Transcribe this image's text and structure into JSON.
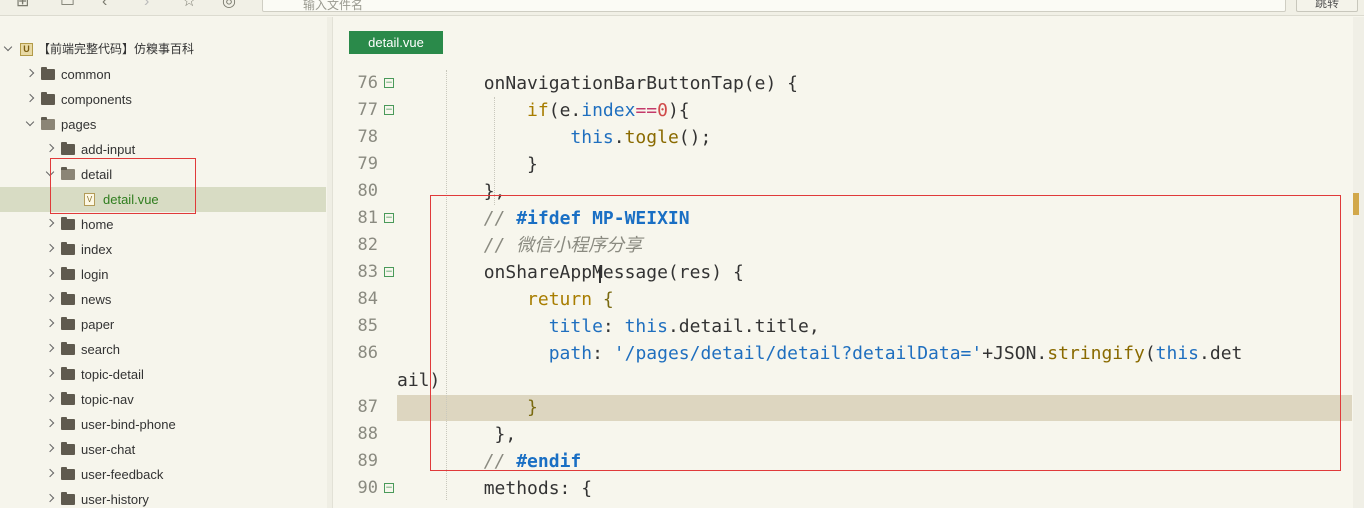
{
  "toolbar": {
    "address_placeholder": "输入文件名",
    "go_button": "跳转"
  },
  "sidebar": {
    "project": "【前端完整代码】仿糗事百科",
    "items": [
      {
        "label": "common",
        "depth": 1,
        "type": "folder",
        "expanded": false
      },
      {
        "label": "components",
        "depth": 1,
        "type": "folder",
        "expanded": false
      },
      {
        "label": "pages",
        "depth": 1,
        "type": "folder",
        "expanded": true
      },
      {
        "label": "add-input",
        "depth": 2,
        "type": "folder",
        "expanded": false
      },
      {
        "label": "detail",
        "depth": 2,
        "type": "folder",
        "expanded": true
      },
      {
        "label": "detail.vue",
        "depth": 3,
        "type": "file",
        "selected": true
      },
      {
        "label": "home",
        "depth": 2,
        "type": "folder",
        "expanded": false
      },
      {
        "label": "index",
        "depth": 2,
        "type": "folder",
        "expanded": false
      },
      {
        "label": "login",
        "depth": 2,
        "type": "folder",
        "expanded": false
      },
      {
        "label": "news",
        "depth": 2,
        "type": "folder",
        "expanded": false
      },
      {
        "label": "paper",
        "depth": 2,
        "type": "folder",
        "expanded": false
      },
      {
        "label": "search",
        "depth": 2,
        "type": "folder",
        "expanded": false
      },
      {
        "label": "topic-detail",
        "depth": 2,
        "type": "folder",
        "expanded": false
      },
      {
        "label": "topic-nav",
        "depth": 2,
        "type": "folder",
        "expanded": false
      },
      {
        "label": "user-bind-phone",
        "depth": 2,
        "type": "folder",
        "expanded": false
      },
      {
        "label": "user-chat",
        "depth": 2,
        "type": "folder",
        "expanded": false
      },
      {
        "label": "user-feedback",
        "depth": 2,
        "type": "folder",
        "expanded": false
      },
      {
        "label": "user-history",
        "depth": 2,
        "type": "folder",
        "expanded": false
      }
    ]
  },
  "editor": {
    "tab": "detail.vue",
    "lines": [
      {
        "n": "76",
        "fold": true,
        "tokens": [
          [
            "def",
            "        onNavigationBarButtonTap(e) {"
          ]
        ]
      },
      {
        "n": "77",
        "fold": true,
        "tokens": [
          [
            "def",
            "            "
          ],
          [
            "kw",
            "if"
          ],
          [
            "def",
            "(e."
          ],
          [
            "prop",
            "index"
          ],
          [
            "op",
            "=="
          ],
          [
            "num",
            "0"
          ],
          [
            "def",
            "){"
          ]
        ]
      },
      {
        "n": "78",
        "fold": false,
        "tokens": [
          [
            "def",
            "                "
          ],
          [
            "this",
            "this"
          ],
          [
            "def",
            "."
          ],
          [
            "fn",
            "togle"
          ],
          [
            "def",
            "();"
          ]
        ]
      },
      {
        "n": "79",
        "fold": false,
        "tokens": [
          [
            "def",
            "            }"
          ]
        ]
      },
      {
        "n": "80",
        "fold": false,
        "tokens": [
          [
            "def",
            "        },"
          ]
        ]
      },
      {
        "n": "81",
        "fold": true,
        "tokens": [
          [
            "def",
            "        "
          ],
          [
            "com",
            "// "
          ],
          [
            "pre",
            "#ifdef MP-WEIXIN"
          ]
        ]
      },
      {
        "n": "82",
        "fold": false,
        "tokens": [
          [
            "def",
            "        "
          ],
          [
            "com",
            "// 微信小程序分享"
          ]
        ]
      },
      {
        "n": "83",
        "fold": true,
        "tokens": [
          [
            "def",
            "        onShareAppMessage(res) {"
          ]
        ]
      },
      {
        "n": "84",
        "fold": false,
        "tokens": [
          [
            "def",
            "            "
          ],
          [
            "kw",
            "return"
          ],
          [
            "def",
            " "
          ],
          [
            "brace",
            "{"
          ]
        ]
      },
      {
        "n": "85",
        "fold": false,
        "tokens": [
          [
            "def",
            "              "
          ],
          [
            "prop",
            "title"
          ],
          [
            "def",
            ": "
          ],
          [
            "this",
            "this"
          ],
          [
            "def",
            ".detail.title,"
          ]
        ]
      },
      {
        "n": "86",
        "fold": false,
        "tokens": [
          [
            "def",
            "              "
          ],
          [
            "prop",
            "path"
          ],
          [
            "def",
            ": "
          ],
          [
            "str",
            "'/pages/detail/detail?detailData='"
          ],
          [
            "def",
            "+JSON."
          ],
          [
            "fn",
            "stringify"
          ],
          [
            "def",
            "("
          ],
          [
            "this",
            "this"
          ],
          [
            "def",
            ".det"
          ]
        ]
      },
      {
        "n": "",
        "fold": false,
        "wrap": true,
        "tokens": [
          [
            "def",
            "ail)"
          ]
        ]
      },
      {
        "n": "87",
        "fold": false,
        "current": true,
        "tokens": [
          [
            "def",
            "            "
          ],
          [
            "brace",
            "}"
          ]
        ]
      },
      {
        "n": "88",
        "fold": false,
        "tokens": [
          [
            "def",
            "         },"
          ]
        ]
      },
      {
        "n": "89",
        "fold": false,
        "tokens": [
          [
            "def",
            "        "
          ],
          [
            "com",
            "// "
          ],
          [
            "pre",
            "#endif"
          ]
        ]
      },
      {
        "n": "90",
        "fold": true,
        "tokens": [
          [
            "def",
            "        methods: {"
          ]
        ]
      }
    ]
  }
}
